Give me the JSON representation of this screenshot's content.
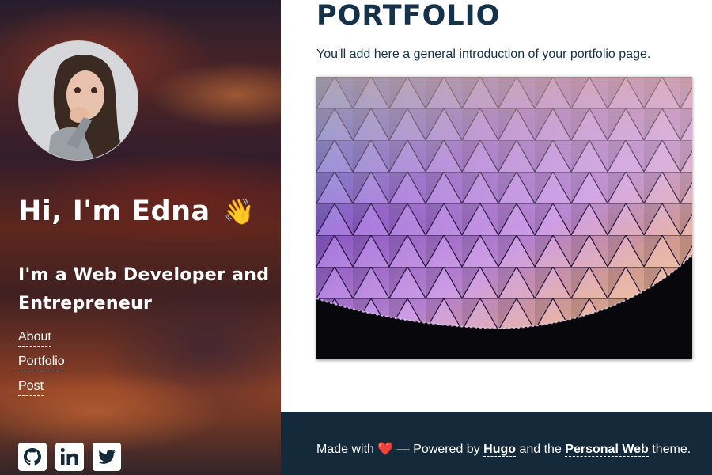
{
  "sidebar": {
    "greeting": "Hi, I'm Edna",
    "greeting_emoji": "👋",
    "tagline": "I'm a Web Developer and Entrepreneur",
    "nav": [
      {
        "label": "About"
      },
      {
        "label": "Portfolio"
      },
      {
        "label": "Post"
      }
    ],
    "social_icons": [
      "github-icon",
      "linkedin-icon",
      "twitter-icon"
    ]
  },
  "main": {
    "title": "PORTFOLIO",
    "intro": "You'll add here a general introduction of your portfolio page."
  },
  "footer": {
    "made_with": "Made with",
    "heart": "❤️",
    "powered_by": "— Powered by",
    "hugo_link": "Hugo",
    "and_the": "and the",
    "theme_link": "Personal Web",
    "theme_word": "theme."
  },
  "colors": {
    "heading": "#14324a",
    "footer_bg": "#14293a",
    "sidebar_text": "#ffffff"
  }
}
